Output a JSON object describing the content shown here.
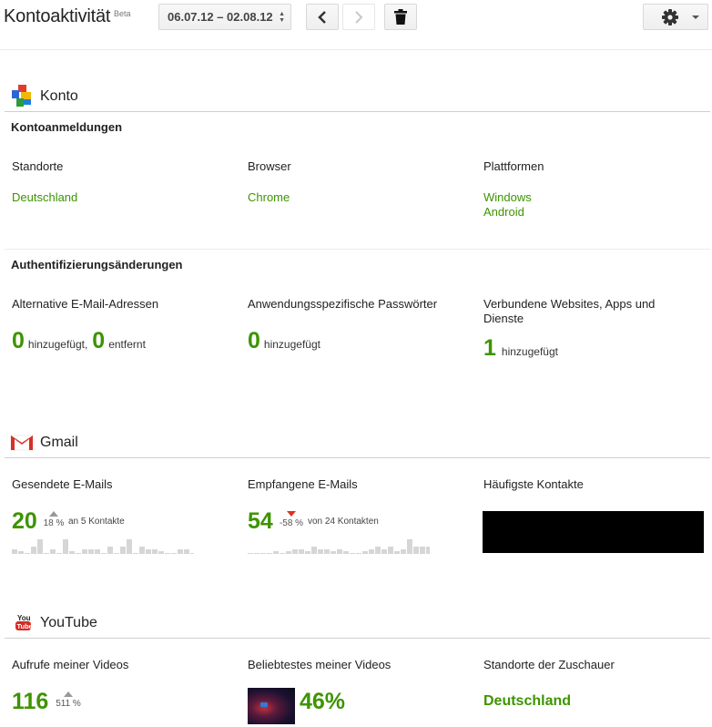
{
  "header": {
    "title": "Kontoaktivität",
    "beta": "Beta",
    "date_range": "06.07.12 – 02.08.12",
    "icons": [
      "chevron-left-icon",
      "chevron-right-icon",
      "trash-icon",
      "gear-icon",
      "caret-down-icon"
    ]
  },
  "konto": {
    "title": "Konto",
    "logins": {
      "heading": "Kontoanmeldungen",
      "locations_label": "Standorte",
      "locations": [
        "Deutschland"
      ],
      "browser_label": "Browser",
      "browsers": [
        "Chrome"
      ],
      "platforms_label": "Plattformen",
      "platforms": [
        "Windows",
        "Android"
      ]
    },
    "auth": {
      "heading": "Authentifizierungsänderungen",
      "alt_email_label": "Alternative E-Mail-Adressen",
      "alt_email_added": "0",
      "alt_email_added_text": "hinzugefügt,",
      "alt_email_removed": "0",
      "alt_email_removed_text": "entfernt",
      "app_pw_label": "Anwendungsspezifische Passwörter",
      "app_pw_added": "0",
      "app_pw_added_text": "hinzugefügt",
      "connected_label": "Verbundene Websites, Apps und Dienste",
      "connected_added": "1",
      "connected_added_text": "hinzugefügt"
    }
  },
  "gmail": {
    "title": "Gmail",
    "sent_label": "Gesendete E-Mails",
    "sent_count": "20",
    "sent_delta": "18 %",
    "sent_delta_dir": "up",
    "sent_note": "an 5 Kontakte",
    "sent_spark": [
      2,
      1,
      0,
      3,
      6,
      0,
      2,
      0,
      6,
      1,
      0,
      2,
      2,
      2,
      0,
      3,
      0,
      3,
      6,
      0,
      3,
      2,
      2,
      1,
      0,
      0,
      2,
      2,
      0
    ],
    "received_label": "Empfangene E-Mails",
    "received_count": "54",
    "received_delta": "-58 %",
    "received_delta_dir": "down",
    "received_note": "von 24 Kontakten",
    "received_spark": [
      0,
      0,
      0,
      0,
      1,
      0,
      1,
      2,
      2,
      1,
      3,
      2,
      2,
      1,
      2,
      1,
      0,
      0,
      1,
      2,
      3,
      2,
      3,
      1,
      2,
      6,
      3,
      3,
      3,
      2,
      1,
      0,
      0
    ],
    "frequent_label": "Häufigste Kontakte"
  },
  "youtube": {
    "title": "YouTube",
    "views_label": "Aufrufe meiner Videos",
    "views_count": "116",
    "views_delta": "511 %",
    "views_delta_dir": "up",
    "popular_label": "Beliebtestes meiner Videos",
    "popular_percent": "46%",
    "viewer_locations_label": "Standorte der Zuschauer",
    "viewer_location": "Deutschland"
  },
  "colors": {
    "green": "#3d9400",
    "spark": "#d6d6d6",
    "delta_down": "#dd3322",
    "delta_up": "#999999"
  }
}
